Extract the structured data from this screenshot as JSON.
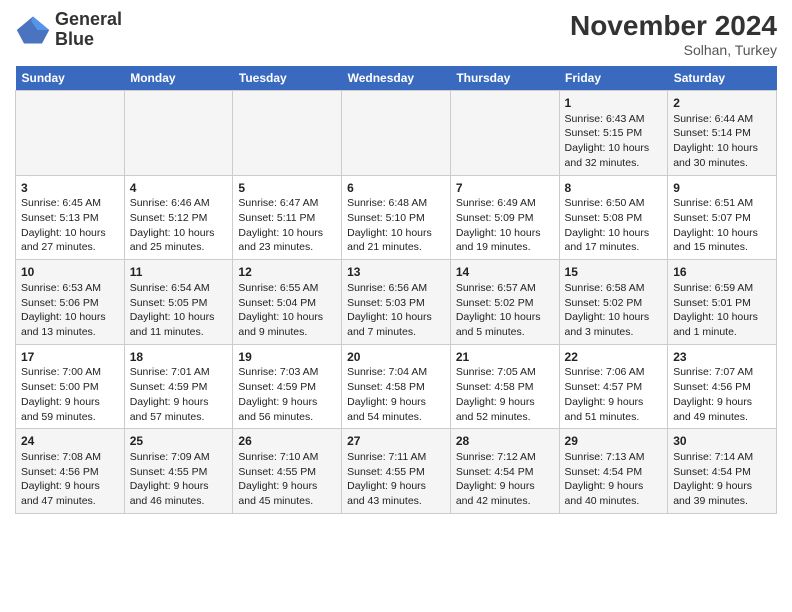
{
  "header": {
    "logo_line1": "General",
    "logo_line2": "Blue",
    "month": "November 2024",
    "location": "Solhan, Turkey"
  },
  "days_of_week": [
    "Sunday",
    "Monday",
    "Tuesday",
    "Wednesday",
    "Thursday",
    "Friday",
    "Saturday"
  ],
  "weeks": [
    [
      {
        "day": "",
        "info": ""
      },
      {
        "day": "",
        "info": ""
      },
      {
        "day": "",
        "info": ""
      },
      {
        "day": "",
        "info": ""
      },
      {
        "day": "",
        "info": ""
      },
      {
        "day": "1",
        "info": "Sunrise: 6:43 AM\nSunset: 5:15 PM\nDaylight: 10 hours and 32 minutes."
      },
      {
        "day": "2",
        "info": "Sunrise: 6:44 AM\nSunset: 5:14 PM\nDaylight: 10 hours and 30 minutes."
      }
    ],
    [
      {
        "day": "3",
        "info": "Sunrise: 6:45 AM\nSunset: 5:13 PM\nDaylight: 10 hours and 27 minutes."
      },
      {
        "day": "4",
        "info": "Sunrise: 6:46 AM\nSunset: 5:12 PM\nDaylight: 10 hours and 25 minutes."
      },
      {
        "day": "5",
        "info": "Sunrise: 6:47 AM\nSunset: 5:11 PM\nDaylight: 10 hours and 23 minutes."
      },
      {
        "day": "6",
        "info": "Sunrise: 6:48 AM\nSunset: 5:10 PM\nDaylight: 10 hours and 21 minutes."
      },
      {
        "day": "7",
        "info": "Sunrise: 6:49 AM\nSunset: 5:09 PM\nDaylight: 10 hours and 19 minutes."
      },
      {
        "day": "8",
        "info": "Sunrise: 6:50 AM\nSunset: 5:08 PM\nDaylight: 10 hours and 17 minutes."
      },
      {
        "day": "9",
        "info": "Sunrise: 6:51 AM\nSunset: 5:07 PM\nDaylight: 10 hours and 15 minutes."
      }
    ],
    [
      {
        "day": "10",
        "info": "Sunrise: 6:53 AM\nSunset: 5:06 PM\nDaylight: 10 hours and 13 minutes."
      },
      {
        "day": "11",
        "info": "Sunrise: 6:54 AM\nSunset: 5:05 PM\nDaylight: 10 hours and 11 minutes."
      },
      {
        "day": "12",
        "info": "Sunrise: 6:55 AM\nSunset: 5:04 PM\nDaylight: 10 hours and 9 minutes."
      },
      {
        "day": "13",
        "info": "Sunrise: 6:56 AM\nSunset: 5:03 PM\nDaylight: 10 hours and 7 minutes."
      },
      {
        "day": "14",
        "info": "Sunrise: 6:57 AM\nSunset: 5:02 PM\nDaylight: 10 hours and 5 minutes."
      },
      {
        "day": "15",
        "info": "Sunrise: 6:58 AM\nSunset: 5:02 PM\nDaylight: 10 hours and 3 minutes."
      },
      {
        "day": "16",
        "info": "Sunrise: 6:59 AM\nSunset: 5:01 PM\nDaylight: 10 hours and 1 minute."
      }
    ],
    [
      {
        "day": "17",
        "info": "Sunrise: 7:00 AM\nSunset: 5:00 PM\nDaylight: 9 hours and 59 minutes."
      },
      {
        "day": "18",
        "info": "Sunrise: 7:01 AM\nSunset: 4:59 PM\nDaylight: 9 hours and 57 minutes."
      },
      {
        "day": "19",
        "info": "Sunrise: 7:03 AM\nSunset: 4:59 PM\nDaylight: 9 hours and 56 minutes."
      },
      {
        "day": "20",
        "info": "Sunrise: 7:04 AM\nSunset: 4:58 PM\nDaylight: 9 hours and 54 minutes."
      },
      {
        "day": "21",
        "info": "Sunrise: 7:05 AM\nSunset: 4:58 PM\nDaylight: 9 hours and 52 minutes."
      },
      {
        "day": "22",
        "info": "Sunrise: 7:06 AM\nSunset: 4:57 PM\nDaylight: 9 hours and 51 minutes."
      },
      {
        "day": "23",
        "info": "Sunrise: 7:07 AM\nSunset: 4:56 PM\nDaylight: 9 hours and 49 minutes."
      }
    ],
    [
      {
        "day": "24",
        "info": "Sunrise: 7:08 AM\nSunset: 4:56 PM\nDaylight: 9 hours and 47 minutes."
      },
      {
        "day": "25",
        "info": "Sunrise: 7:09 AM\nSunset: 4:55 PM\nDaylight: 9 hours and 46 minutes."
      },
      {
        "day": "26",
        "info": "Sunrise: 7:10 AM\nSunset: 4:55 PM\nDaylight: 9 hours and 45 minutes."
      },
      {
        "day": "27",
        "info": "Sunrise: 7:11 AM\nSunset: 4:55 PM\nDaylight: 9 hours and 43 minutes."
      },
      {
        "day": "28",
        "info": "Sunrise: 7:12 AM\nSunset: 4:54 PM\nDaylight: 9 hours and 42 minutes."
      },
      {
        "day": "29",
        "info": "Sunrise: 7:13 AM\nSunset: 4:54 PM\nDaylight: 9 hours and 40 minutes."
      },
      {
        "day": "30",
        "info": "Sunrise: 7:14 AM\nSunset: 4:54 PM\nDaylight: 9 hours and 39 minutes."
      }
    ]
  ]
}
